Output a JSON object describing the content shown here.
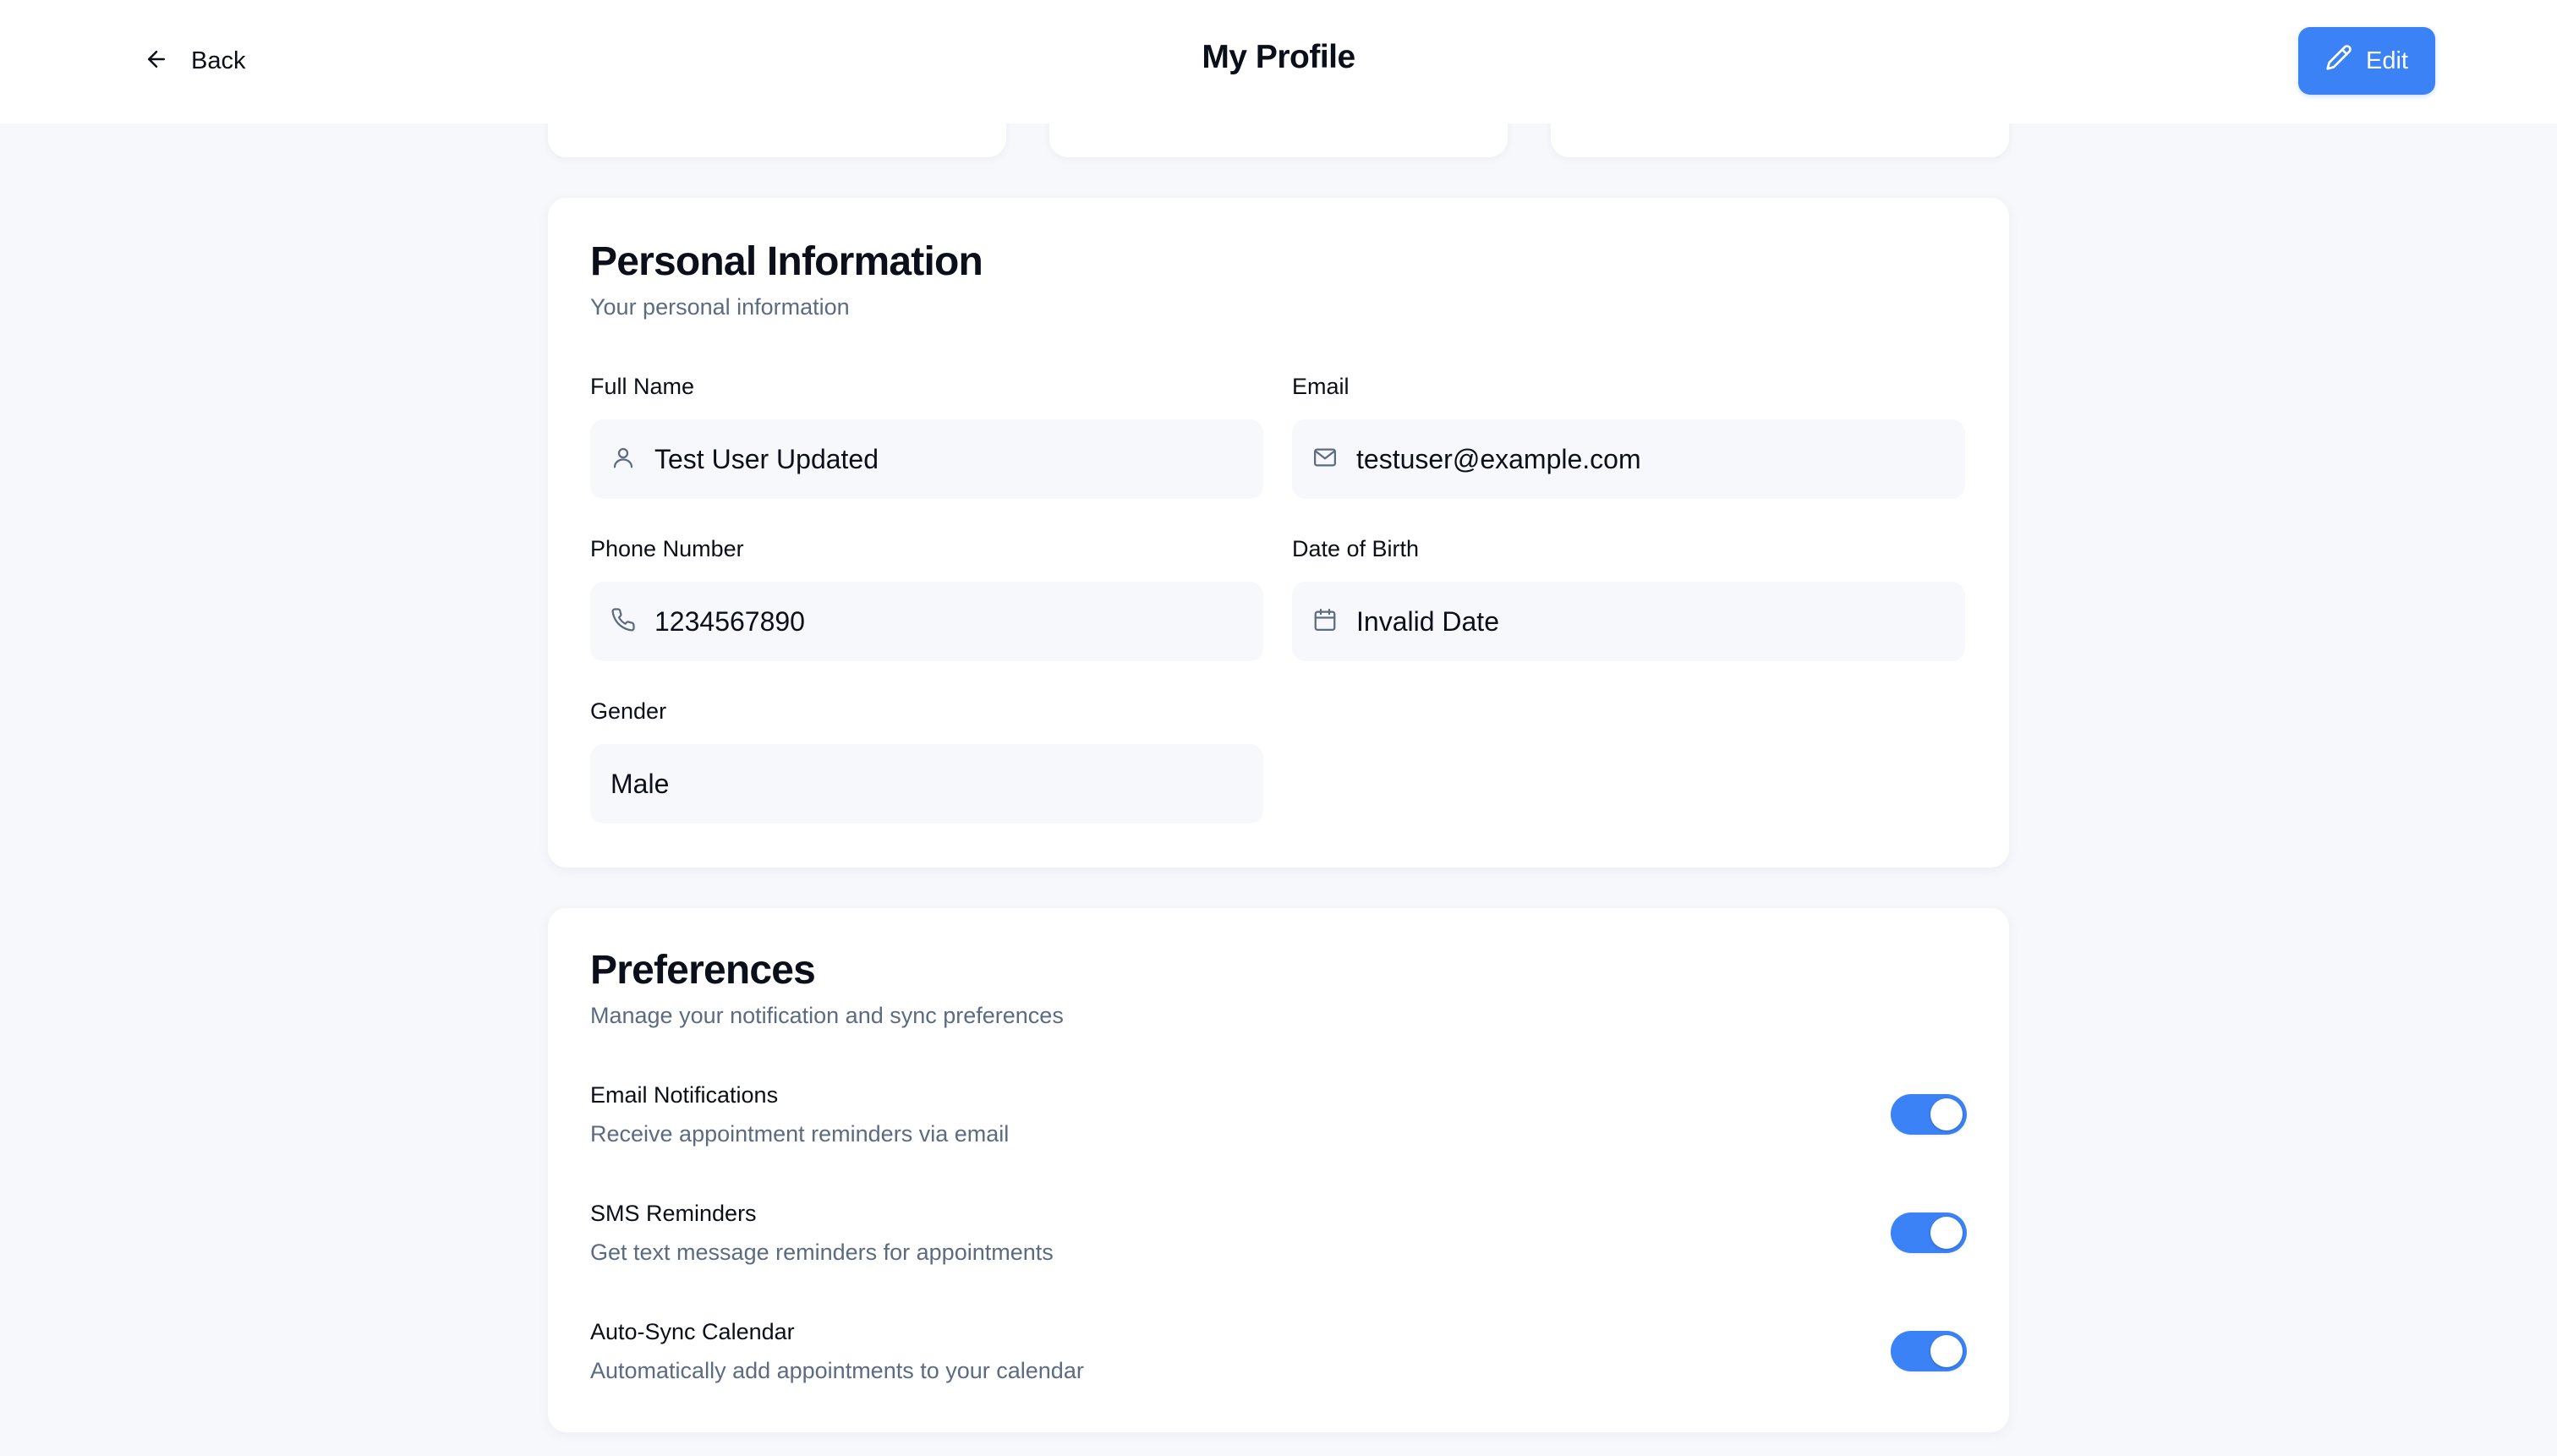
{
  "header": {
    "back_label": "Back",
    "title": "My Profile",
    "edit_label": "Edit"
  },
  "personal": {
    "title": "Personal Information",
    "subtitle": "Your personal information",
    "fields": {
      "full_name": {
        "label": "Full Name",
        "value": "Test User Updated",
        "icon": "user-icon"
      },
      "email": {
        "label": "Email",
        "value": "testuser@example.com",
        "icon": "mail-icon"
      },
      "phone": {
        "label": "Phone Number",
        "value": "1234567890",
        "icon": "phone-icon"
      },
      "dob": {
        "label": "Date of Birth",
        "value": "Invalid Date",
        "icon": "calendar-icon"
      },
      "gender": {
        "label": "Gender",
        "value": "Male"
      }
    }
  },
  "preferences": {
    "title": "Preferences",
    "subtitle": "Manage your notification and sync preferences",
    "items": [
      {
        "title": "Email Notifications",
        "description": "Receive appointment reminders via email",
        "enabled": true
      },
      {
        "title": "SMS Reminders",
        "description": "Get text message reminders for appointments",
        "enabled": true
      },
      {
        "title": "Auto-Sync Calendar",
        "description": "Automatically add appointments to your calendar",
        "enabled": true
      }
    ]
  },
  "colors": {
    "accent": "#3b82f6",
    "background": "#f7f8fc",
    "muted_text": "#5b6b82"
  }
}
